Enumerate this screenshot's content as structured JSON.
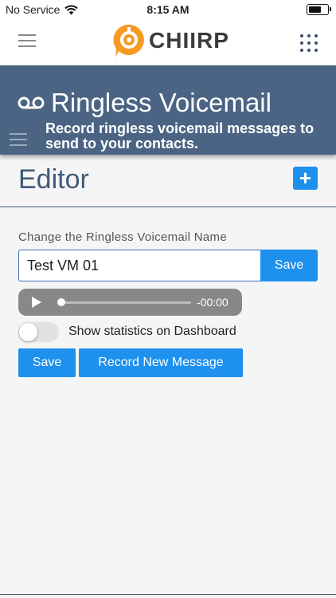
{
  "status_bar": {
    "carrier": "No Service",
    "time": "8:15 AM",
    "battery_level": 0.7
  },
  "header": {
    "brand": "CHIIRP",
    "icons": [
      "hamburger-menu-icon",
      "chiirp-logo-icon",
      "apps-grid-icon"
    ]
  },
  "banner": {
    "title": "Ringless Voicemail",
    "subtitle": "Record ringless voicemail messages to send to your contacts.",
    "icons": [
      "voicemail-icon",
      "hamburger-menu-icon"
    ]
  },
  "editor": {
    "title": "Editor",
    "add_label": "+",
    "name_label": "Change the Ringless Voicemail Name",
    "name_value": "Test VM 01",
    "name_save_label": "Save",
    "audio": {
      "time": "-00:00",
      "progress": 0
    },
    "toggle": {
      "label": "Show statistics on Dashboard",
      "on": false
    },
    "save_label": "Save",
    "record_label": "Record New Message"
  },
  "colors": {
    "brand_orange": "#f59a23",
    "banner_bg": "#4b6483",
    "accent_blue": "#1e90ee",
    "editor_title": "#3f5a78"
  }
}
